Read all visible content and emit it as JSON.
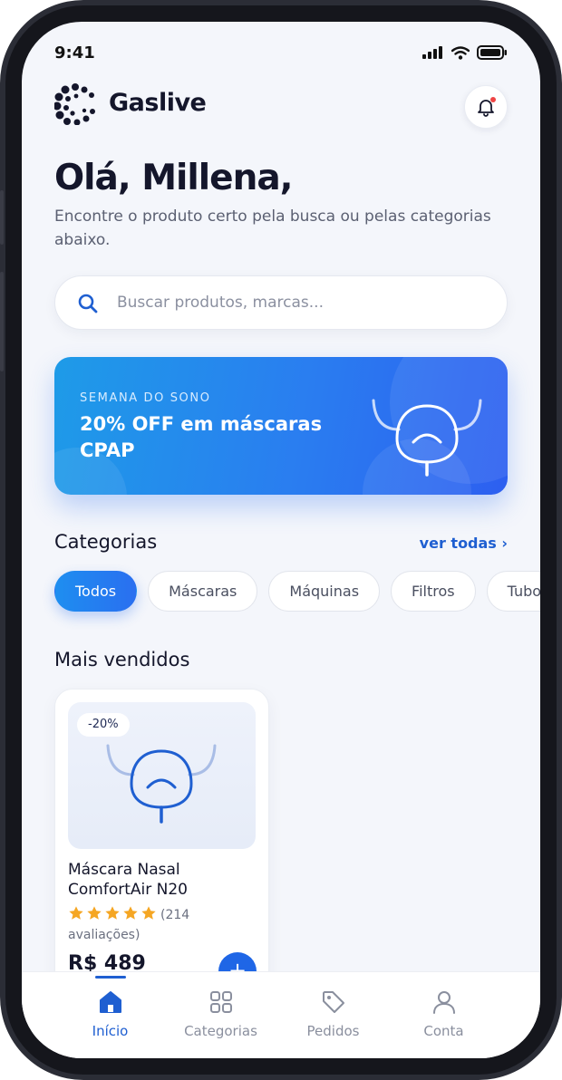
{
  "status_bar": {
    "time": "9:41"
  },
  "header": {
    "brand": "Gaslive"
  },
  "greeting": "Olá, Millena,",
  "subtitle": "Encontre o produto certo pela busca ou pelas categorias abaixo.",
  "search": {
    "placeholder": "Buscar produtos, marcas..."
  },
  "banner": {
    "eyebrow": "SEMANA DO SONO",
    "title": "20% OFF em máscaras CPAP"
  },
  "categories": {
    "title": "Categorias",
    "see_all": "ver todas ›",
    "chips": [
      "Todos",
      "Máscaras",
      "Máquinas",
      "Filtros",
      "Tubos"
    ],
    "active": "Todos"
  },
  "best_sellers": {
    "title": "Mais vendidos",
    "products": [
      {
        "discount": "-20%",
        "name": "Máscara Nasal ComfortAir N20",
        "rating_stars": 5,
        "reviews": "(214 avaliações)",
        "price": "R$ 489",
        "add_label": "+"
      }
    ]
  },
  "tabbar": {
    "items": [
      {
        "label": "Início",
        "icon": "home-icon",
        "active": true
      },
      {
        "label": "Categorias",
        "icon": "grid-icon",
        "active": false
      },
      {
        "label": "Pedidos",
        "icon": "tag-icon",
        "active": false
      },
      {
        "label": "Conta",
        "icon": "user-icon",
        "active": false
      }
    ]
  },
  "colors": {
    "accent": "#1f5fd1",
    "banner_start": "#1e9be8",
    "banner_end": "#2d5ff0",
    "star": "#f5a623"
  }
}
